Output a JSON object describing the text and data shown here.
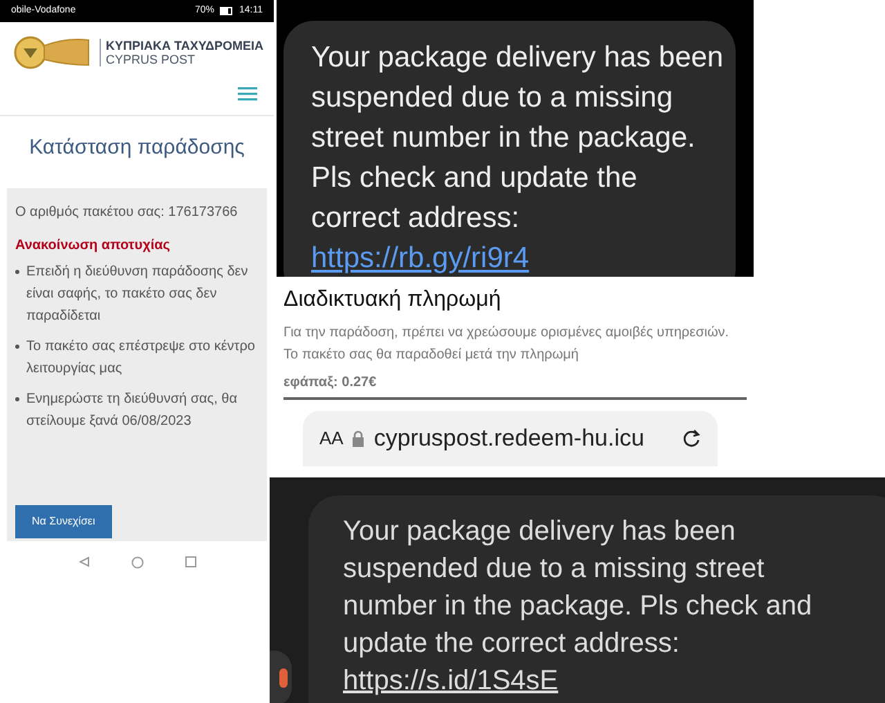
{
  "post_screen": {
    "status_bar": {
      "carrier": "obile-Vodafone",
      "battery": "70%",
      "time": "14:11"
    },
    "logo": {
      "name": "ΚΥΠΡΙΑΚΑ ΤΑΧΥΔΡΟΜΕΙΑ",
      "subtitle": "CYPRUS POST"
    },
    "title": "Κατάσταση παράδοσης",
    "package_number": "Ο αριθμός πακέτου σας: 176173766",
    "notice": "Ανακοίνωση αποτυχίας",
    "bullets": [
      "Επειδή η διεύθυνση παράδοσης δεν είναι σαφής, το πακέτο σας δεν παραδίδεται",
      "Το πακέτο σας επέστρεψε στο κέντρο λειτουργίας μας",
      "Ενημερώστε τη διεύθυνσή σας, θα στείλουμε ξανά 06/08/2023"
    ],
    "button": "Να Συνεχίσει"
  },
  "sms_top": {
    "text": "Your package delivery has been suspended due to a missing street number in the package. Pls check and update the correct address: ",
    "link": "https://rb.gy/ri9r4"
  },
  "payment_screen": {
    "title": "Διαδικτυακή πληρωμή",
    "description": "Για την παράδοση, πρέπει να χρεώσουμε ορισμένες αμοιβές υπηρεσιών. Το πακέτο σας θα παραδοθεί μετά την πληρωμή",
    "fee": "εφάπαξ: 0.27€",
    "address_bar": {
      "text_size": "AA",
      "url": "cypruspost.redeem-hu.icu"
    }
  },
  "sms_bottom": {
    "text": "Your package delivery has been suspended due to a missing street number in the package. Pls check and update the correct address: ",
    "link": "https://s.id/1S4sE"
  }
}
